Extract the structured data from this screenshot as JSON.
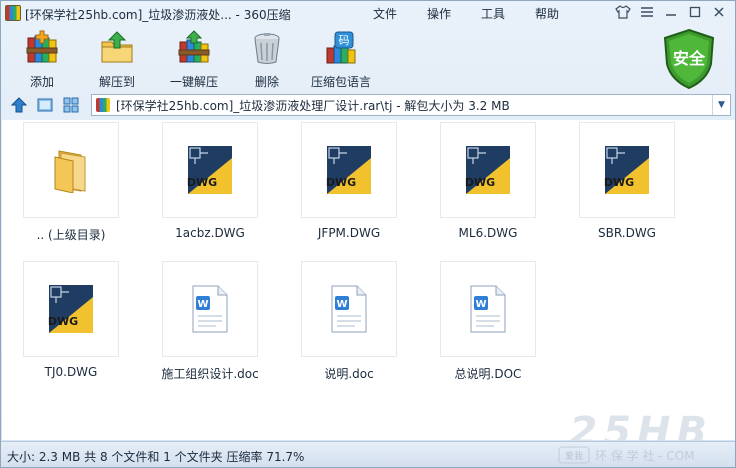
{
  "window": {
    "title": "[环保学社25hb.com]_垃圾渗沥液处... - 360压缩",
    "menu": [
      "文件",
      "操作",
      "工具",
      "帮助"
    ]
  },
  "toolbar": {
    "buttons": [
      {
        "label": "添加",
        "icon": "add-books-icon"
      },
      {
        "label": "解压到",
        "icon": "extract-to-folder-icon"
      },
      {
        "label": "一键解压",
        "icon": "one-click-extract-icon"
      },
      {
        "label": "删除",
        "icon": "trash-icon"
      },
      {
        "label": "压缩包语言",
        "icon": "archive-language-icon"
      }
    ],
    "security_label": "安全",
    "language_badge": "码"
  },
  "address": {
    "path": "[环保学社25hb.com]_垃圾渗沥液处理厂设计.rar\\tj - 解包大小为 3.2 MB"
  },
  "files": [
    {
      "name": ".. (上级目录)",
      "type": "folder"
    },
    {
      "name": "1acbz.DWG",
      "type": "dwg"
    },
    {
      "name": "JFPM.DWG",
      "type": "dwg"
    },
    {
      "name": "ML6.DWG",
      "type": "dwg"
    },
    {
      "name": "SBR.DWG",
      "type": "dwg"
    },
    {
      "name": "TJ0.DWG",
      "type": "dwg"
    },
    {
      "name": "施工组织设计.doc",
      "type": "doc"
    },
    {
      "name": "说明.doc",
      "type": "doc"
    },
    {
      "name": "总说明.DOC",
      "type": "doc"
    }
  ],
  "dwg_badge": "DWG",
  "status": {
    "text": "大小: 2.3 MB 共 8 个文件和 1 个文件夹 压缩率 71.7%"
  },
  "watermark": {
    "logo": "25HB",
    "subtitle": "环 保 学 社 - COM",
    "badge": "爱我"
  },
  "colors": {
    "accent": "#2e6fb3",
    "shield": "#3d9a2e",
    "dwg_yellow": "#f2c12e",
    "doc_blue": "#2f7fd8"
  }
}
